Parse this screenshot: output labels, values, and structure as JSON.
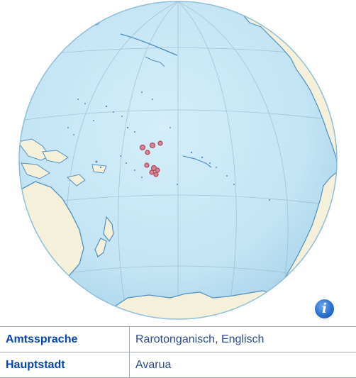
{
  "map": {
    "highlight_color": "#b0485a",
    "ocean_color": "#c6e6f5",
    "land_color": "#f5f0da",
    "coast_color": "#4f90bf"
  },
  "info_button": {
    "icon": "info-icon",
    "glyph": "i"
  },
  "table": {
    "rows": [
      {
        "label": "Amtssprache",
        "value": "Rarotonganisch, Englisch"
      },
      {
        "label": "Hauptstadt",
        "value": "Avarua"
      }
    ]
  }
}
